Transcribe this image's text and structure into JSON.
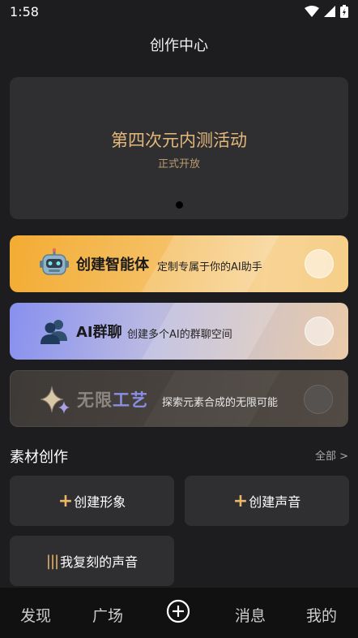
{
  "status": {
    "time": "1:58"
  },
  "header": {
    "title": "创作中心"
  },
  "banner": {
    "title": "第四次元内测活动",
    "subtitle": "正式开放"
  },
  "cards": [
    {
      "title": "创建智能体",
      "desc": "定制专属于你的AI助手",
      "icon": "robot-icon"
    },
    {
      "title": "AI群聊",
      "desc": "创建多个AI的群聊空间",
      "icon": "group-users-icon"
    },
    {
      "title_a": "无限",
      "title_b": "工艺",
      "desc": "探索元素合成的无限可能",
      "icon": "sparkle-icon"
    }
  ],
  "materials": {
    "title": "素材创作",
    "more": "全部 >",
    "buttons": [
      {
        "label": "创建形象",
        "prefix": "+"
      },
      {
        "label": "创建声音",
        "prefix": "+"
      },
      {
        "label": "我复刻的声音",
        "prefix": "|||"
      }
    ]
  },
  "tabs": [
    "发现",
    "广场",
    "消息",
    "我的"
  ],
  "colors": {
    "accent": "#e9b767",
    "banner_title": "#e4b87a"
  }
}
